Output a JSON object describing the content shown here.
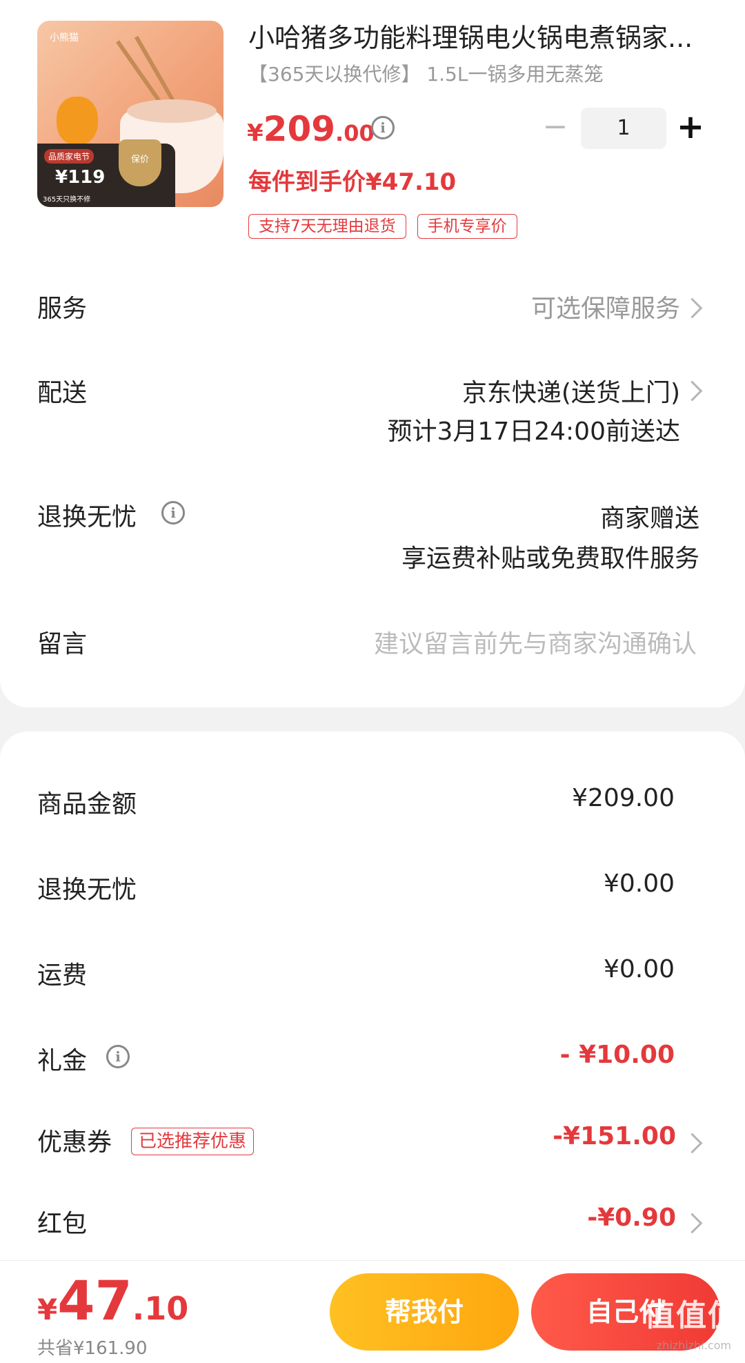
{
  "product": {
    "thumb_brand": "小熊猫",
    "thumb_festival": "品质家电节",
    "thumb_price": "¥119",
    "thumb_sub": "365天只换不修",
    "thumb_seal": "保价",
    "title": "小哈猪多功能料理锅电火锅电煮锅家...",
    "subtitle": "【365天以换代修】 1.5L一锅多用无蒸笼",
    "price_currency": "¥",
    "price_int": "209",
    "price_dec": ".00",
    "quantity": "1",
    "minus_symbol": "−",
    "plus_symbol": "+",
    "unit_price": "每件到手价¥47.10",
    "tags": [
      "支持7天无理由退货",
      "手机专享价"
    ]
  },
  "rows": {
    "service": {
      "label": "服务",
      "value": "可选保障服务"
    },
    "delivery": {
      "label": "配送",
      "value": "京东快递(送货上门)",
      "eta": "预计3月17日24:00前送达"
    },
    "return": {
      "label": "退换无忧",
      "value": "商家赠送",
      "note": "享运费补贴或免费取件服务"
    },
    "message": {
      "label": "留言",
      "placeholder": "建议留言前先与商家沟通确认"
    }
  },
  "summary": {
    "goods": {
      "label": "商品金额",
      "value": "¥209.00"
    },
    "return_fee": {
      "label": "退换无忧",
      "value": "¥0.00"
    },
    "shipping": {
      "label": "运费",
      "value": "¥0.00"
    },
    "gift": {
      "label": "礼金",
      "value": "- ¥10.00"
    },
    "coupon": {
      "label": "优惠券",
      "tag": "已选推荐优惠",
      "value": "-¥151.00"
    },
    "redpacket": {
      "label": "红包",
      "value": "-¥0.90"
    }
  },
  "bottom": {
    "total_currency": "¥",
    "total_int": "47",
    "total_dec": ".10",
    "saved": "共省¥161.90",
    "help_pay": "帮我付",
    "self_pay": "自己付",
    "watermark": "值值值",
    "watermark_url": "zhizhizhi.com"
  },
  "info_glyph": "i",
  "colors": {
    "accent": "#e4393c",
    "help_pay": "#ffb116",
    "self_pay": "#f23f37"
  }
}
